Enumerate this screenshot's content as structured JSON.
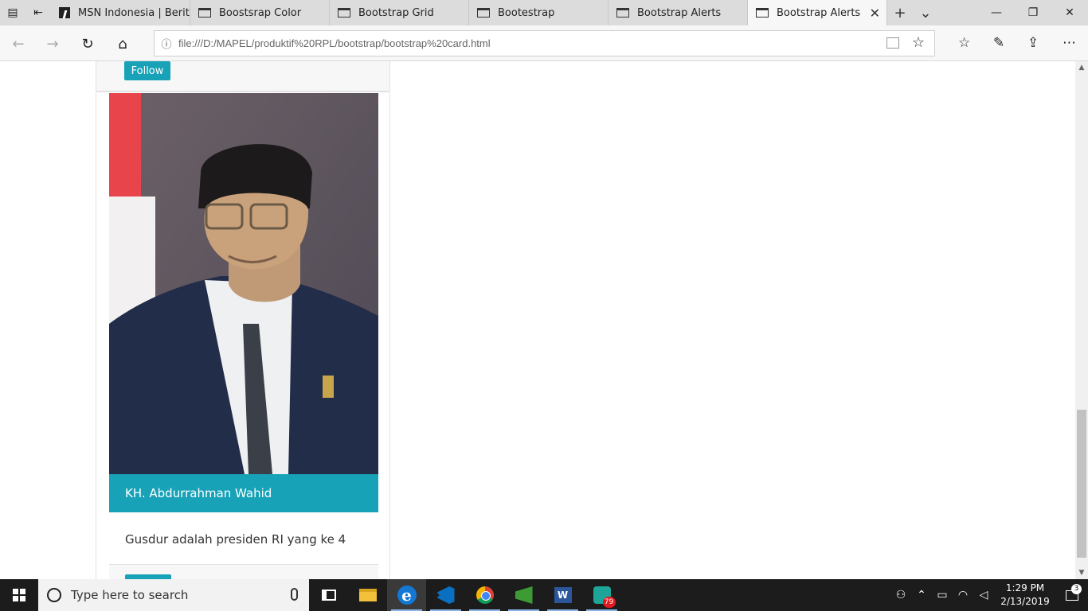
{
  "browser": {
    "tabs": [
      {
        "title": "MSN Indonesia | Berita",
        "active": false
      },
      {
        "title": "Boostsrap Color",
        "active": false
      },
      {
        "title": "Bootstrap Grid",
        "active": false
      },
      {
        "title": "Bootestrap",
        "active": false
      },
      {
        "title": "Bootstrap Alerts",
        "active": false
      },
      {
        "title": "Bootstrap Alerts",
        "active": true
      }
    ],
    "url": "file:///D:/MAPEL/produktif%20RPL/bootstrap/bootstrap%20card.html"
  },
  "page": {
    "prev_card_button": "Follow",
    "card": {
      "title": "KH. Abdurrahman Wahid",
      "text": "Gusdur adalah presiden RI yang ke 4"
    },
    "accent_color": "#17a2b8"
  },
  "taskbar": {
    "search_placeholder": "Type here to search",
    "whatsapp_badge": "79",
    "time": "1:29 PM",
    "date": "2/13/2019",
    "notification_count": "3"
  }
}
